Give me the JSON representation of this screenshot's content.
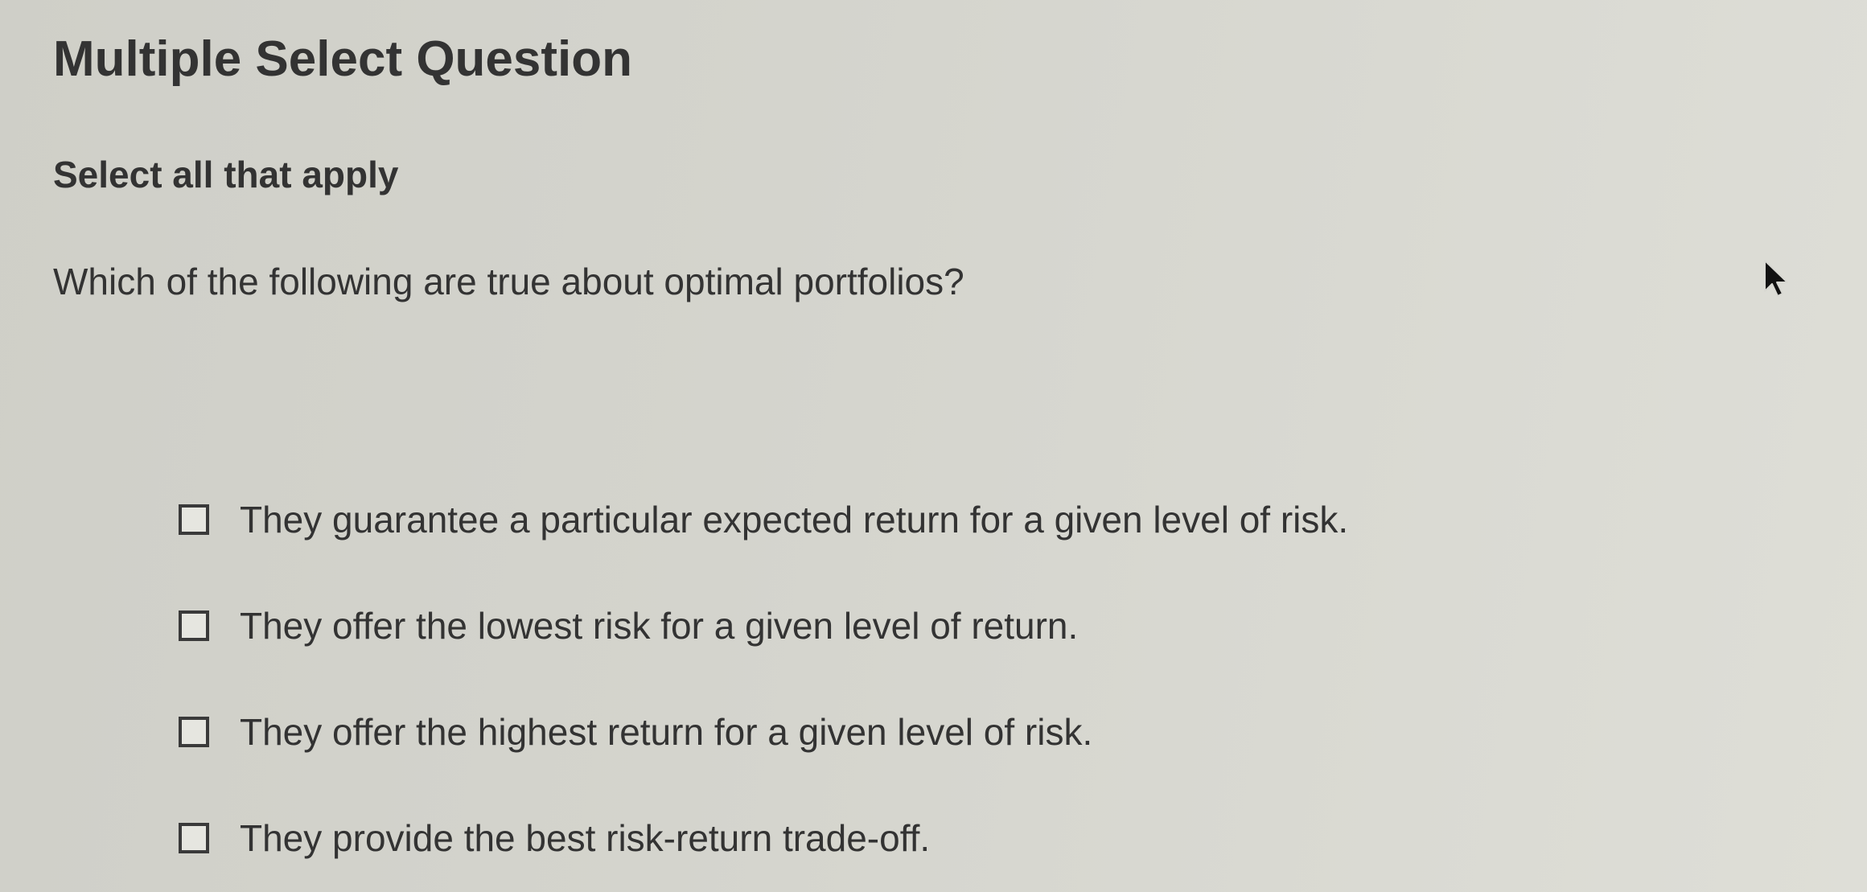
{
  "question": {
    "type_label": "Multiple Select Question",
    "instruction": "Select all that apply",
    "prompt": "Which of the following are true about optimal portfolios?",
    "options": [
      {
        "label": "They guarantee a particular expected return for a given level of risk.",
        "checked": false
      },
      {
        "label": "They offer the lowest risk for a given level of return.",
        "checked": false
      },
      {
        "label": "They offer the highest return for a given level of risk.",
        "checked": false
      },
      {
        "label": "They provide the best risk-return trade-off.",
        "checked": false
      }
    ]
  },
  "icons": {
    "checkbox": "checkbox-icon",
    "cursor": "mouse-pointer-icon"
  },
  "colors": {
    "background": "#d4d4cd",
    "text": "#333333",
    "checkbox_border": "#3a3a3a"
  }
}
